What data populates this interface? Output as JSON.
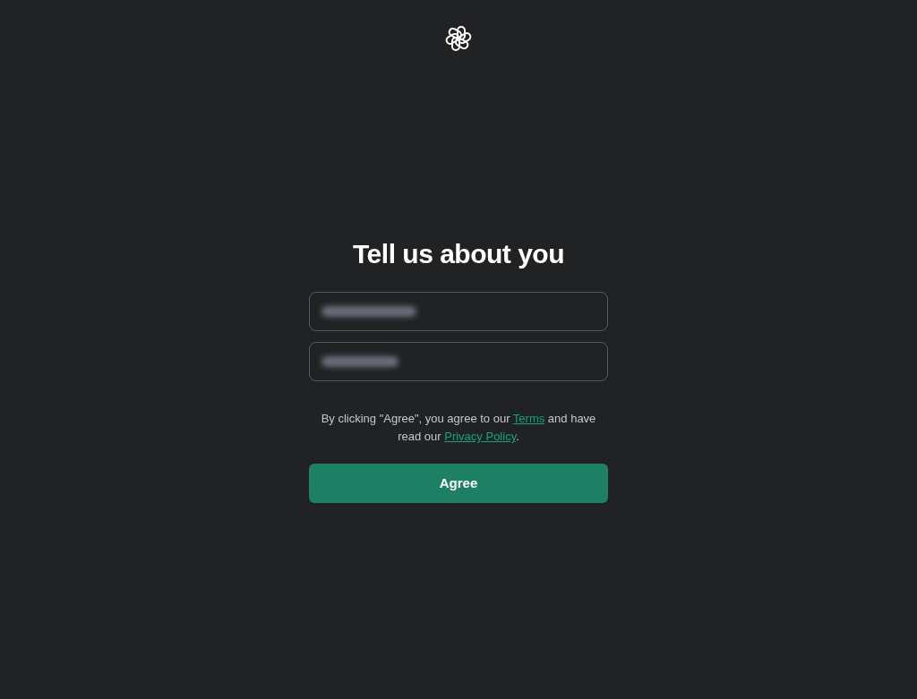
{
  "title": "Tell us about you",
  "fields": [
    {
      "kind": "name",
      "redacted": true
    },
    {
      "kind": "birthday",
      "redacted": true
    }
  ],
  "consent": {
    "before": "By clicking \"Agree\", you agree to our ",
    "terms_link": "Terms",
    "middle": " and have read our ",
    "privacy_link": "Privacy Policy",
    "after": "."
  },
  "button": "Agree"
}
